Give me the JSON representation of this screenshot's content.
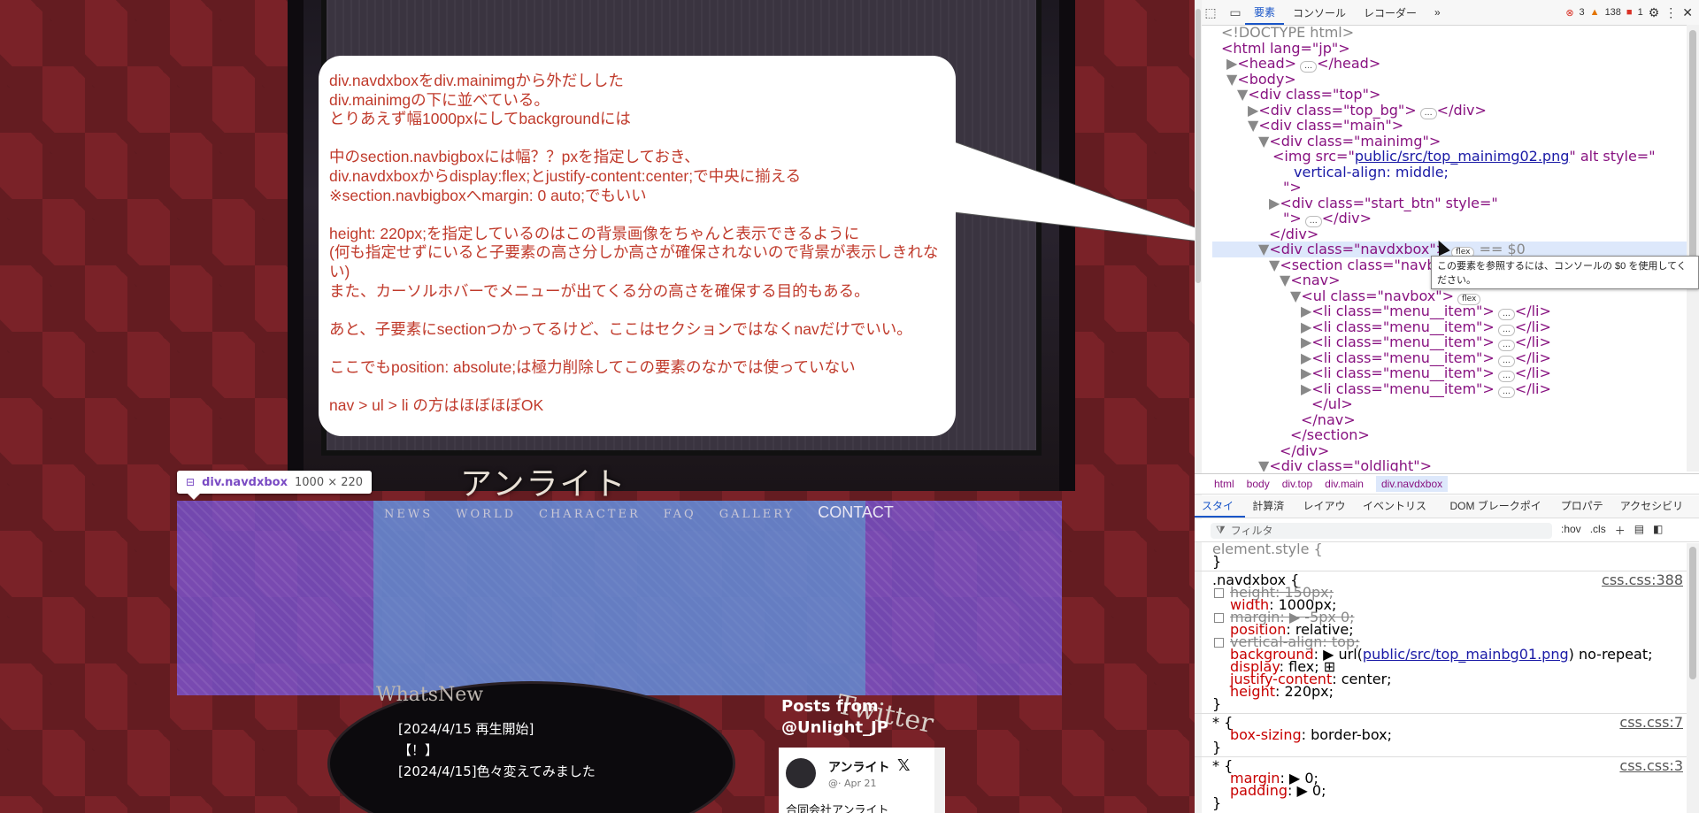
{
  "page": {
    "logo_text": "アンライト",
    "menu": [
      "NEWS",
      "WORLD",
      "CHARACTER",
      "FAQ",
      "GALLERY"
    ],
    "menu_contact": "CONTACT",
    "element_tag": "div.navdxbox",
    "element_size": "1000 × 220",
    "whats_new_title": "WhatsNew",
    "whats_new_items": [
      "[2024/4/15 再生開始]",
      "【！】",
      "[2024/4/15]色々変えてみました"
    ],
    "twitter_title": "Twitter",
    "posts_from": "Posts from",
    "posts_handle": "@Unlight_JP",
    "tweet": {
      "name": "アンライト",
      "x_mark": "𝕏",
      "handle": "@· Apr 21",
      "text": "合同会社アンライト"
    }
  },
  "annotation": [
    "div.navdxboxをdiv.mainimgから外だしした",
    "div.mainimgの下に並べている。",
    "とりあえず幅1000pxにしてbackgroundには",
    "",
    "中のsection.navbigboxには幅？？pxを指定しておき、",
    "div.navdxboxからdisplay:flex;とjustify-content:center;で中央に揃える",
    "※section.navbigboxへmargin: 0 auto;でもいい",
    "",
    "height: 220px;を指定しているのはこの背景画像をちゃんと表示できるように",
    "(何も指定せずにいると子要素の高さ分しか高さが確保されないので背景が表示しきれない)",
    "また、カーソルホバーでメニューが出てくる分の高さを確保する目的もある。",
    "",
    "あと、子要素にsectionつかってるけど、ここはセクションではなくnavだけでいい。",
    "",
    "ここでもposition: absolute;は極力削除してこの要素のなかでは使っていない",
    "",
    "nav > ul > li の方はほぼほぼOK"
  ],
  "devtools": {
    "tabs": [
      "要素",
      "コンソール",
      "レコーダー"
    ],
    "more": "»",
    "errors": "3",
    "warnings": "138",
    "issues": "1",
    "tooltip": "この要素を参照するには、コンソールの $0 を使用してください。",
    "flex_pill": "flex",
    "dollar0": "== $0",
    "dom": {
      "doctype": "<!DOCTYPE html>",
      "html": "<html lang=\"jp\">",
      "head": "<head>",
      "head_close": "</head>",
      "body": "<body>",
      "top": "<div class=\"top\">",
      "top_bg": "<div class=\"top_bg\">",
      "div_close": "</div>",
      "main": "<div class=\"main\">",
      "mainimg": "<div class=\"mainimg\">",
      "img_open": "<img src=\"",
      "img_src": "public/src/top_mainimg02.png",
      "img_rest": "\" alt style=\"",
      "img_style": "vertical-align: middle;",
      "img_end": "\">",
      "start_btn": "<div class=\"start_btn\" style=\"",
      "start_btn_end": "\">",
      "navdxbox": "<div class=\"navdxbox\">",
      "navbigbox": "<section class=\"navbigbox\">",
      "nav": "<nav>",
      "ul": "<ul class=\"navbox\">",
      "li": "<li class=\"menu__item\">",
      "li_close": "</li>",
      "ul_close": "</ul>",
      "nav_close": "</nav>",
      "section_close": "</section>",
      "oldlight": "<div class=\"oldlight\">"
    },
    "breadcrumbs": [
      "html",
      "body",
      "div.top",
      "div.main",
      "div.navdxbox"
    ],
    "style_tabs": [
      "スタイル",
      "計算済み",
      "レイアウト",
      "イベントリスナー",
      "DOM ブレークポイント",
      "プロパティ",
      "アクセシビリティ"
    ],
    "filter_placeholder": "フィルタ",
    "hov": ":hov",
    "cls": ".cls",
    "rules": {
      "element_style": "element.style {",
      "close": "}",
      "navdxbox_sel": ".navdxbox {",
      "navdxbox_src": "css.css:388",
      "p_height_old": "height: 150px;",
      "p_width": "width",
      "v_width": "1000px;",
      "p_margin_old": "margin: ▶ -5px 0;",
      "p_position": "position",
      "v_position": "relative;",
      "p_valign_old": "vertical-align: top;",
      "p_background": "background",
      "v_bg_pre": "▶ url(",
      "v_bg_link": "public/src/top_mainbg01.png",
      "v_bg_post": ") no-repeat;",
      "p_display": "display",
      "v_display": "flex; ⊞",
      "p_justify": "justify-content",
      "v_justify": "center;",
      "p_height": "height",
      "v_height": "220px;",
      "star_sel": "* {",
      "star_src1": "css.css:7",
      "p_box": "box-sizing",
      "v_box": "border-box;",
      "star_src2": "css.css:3",
      "p_margin": "margin",
      "v_margin": "▶ 0;",
      "p_padding": "padding",
      "v_padding": "▶ 0;"
    }
  }
}
